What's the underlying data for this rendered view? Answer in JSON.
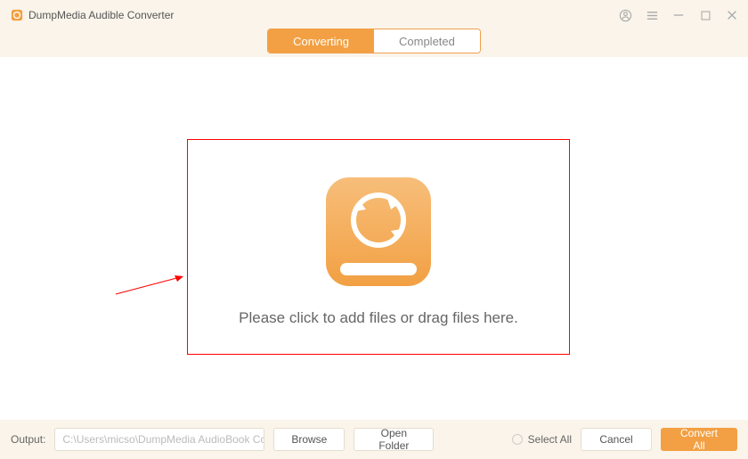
{
  "app": {
    "title": "DumpMedia Audible Converter"
  },
  "tabs": {
    "converting": "Converting",
    "completed": "Completed"
  },
  "main": {
    "drop_text": "Please click to add files or drag files here."
  },
  "footer": {
    "output_label": "Output:",
    "output_path": "C:\\Users\\micso\\DumpMedia AudioBook Co...",
    "browse": "Browse",
    "open_folder": "Open Folder",
    "select_all": "Select All",
    "cancel": "Cancel",
    "convert_all": "Convert All"
  },
  "colors": {
    "accent": "#f2a043",
    "bg_cream": "#faf4ea",
    "highlight_red": "#ff0000"
  }
}
